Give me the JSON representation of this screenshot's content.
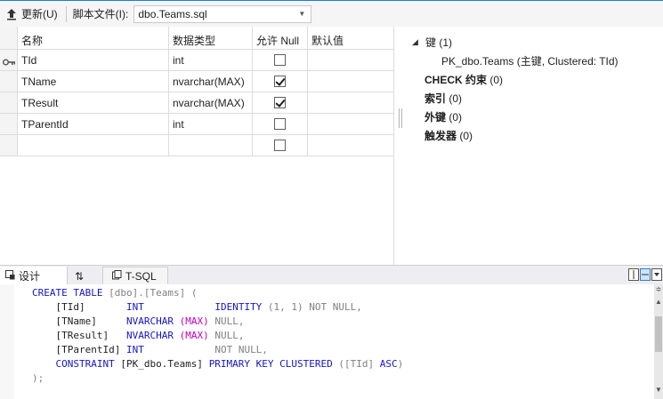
{
  "toolbar": {
    "update_label": "更新(U)",
    "script_file_label": "脚本文件(I):",
    "script_file_value": "dbo.Teams.sql"
  },
  "grid": {
    "headers": [
      "名称",
      "数据类型",
      "允许 Null",
      "默认值"
    ],
    "rows": [
      {
        "name": "TId",
        "type": "int",
        "allow_null": false,
        "primary_key": true
      },
      {
        "name": "TName",
        "type": "nvarchar(MAX)",
        "allow_null": true,
        "primary_key": false
      },
      {
        "name": "TResult",
        "type": "nvarchar(MAX)",
        "allow_null": true,
        "primary_key": false
      },
      {
        "name": "TParentId",
        "type": "int",
        "allow_null": false,
        "primary_key": false
      },
      {
        "name": "",
        "type": "",
        "allow_null": false,
        "primary_key": false
      }
    ]
  },
  "properties": {
    "keys_label": "键",
    "keys_count": "(1)",
    "key_entry": "PK_dbo.Teams (主键, Clustered: TId)",
    "check_label": "CHECK 约束",
    "check_count": "(0)",
    "index_label": "索引",
    "index_count": "(0)",
    "fk_label": "外键",
    "fk_count": "(0)",
    "trigger_label": "触发器",
    "trigger_count": "(0)"
  },
  "tabs": {
    "design": "设计",
    "swap": "⇅",
    "tsql": "T-SQL"
  },
  "sql": {
    "l1_kw": "CREATE TABLE",
    "l1_tx": " [dbo].[Teams] (",
    "l2_col": "    [TId]",
    "l2_type": "INT",
    "l2_rest_kw": "IDENTITY",
    "l2_rest": " (1, 1) NOT NULL,",
    "l3_col": "    [TName]",
    "l3_type": "NVARCHAR",
    "l3_max": "(MAX)",
    "l3_rest": " NULL,",
    "l4_col": "    [TResult]",
    "l4_type": "NVARCHAR",
    "l4_max": "(MAX)",
    "l4_rest": " NULL,",
    "l5_col": "    [TParentId]",
    "l5_type": "INT",
    "l5_rest": "NOT NULL,",
    "l6_kw": "    CONSTRAINT",
    "l6_tx": " [PK_dbo.Teams] ",
    "l6_kw2": "PRIMARY KEY CLUSTERED",
    "l6_tx2": " ([TId] ",
    "l6_asc": "ASC",
    "l6_end": ")",
    "l7": ");"
  },
  "colors": {
    "keyword": "#1515c8",
    "max_keyword": "#c000c0",
    "punctuation": "#808080",
    "accent": "#1c7ed6"
  }
}
